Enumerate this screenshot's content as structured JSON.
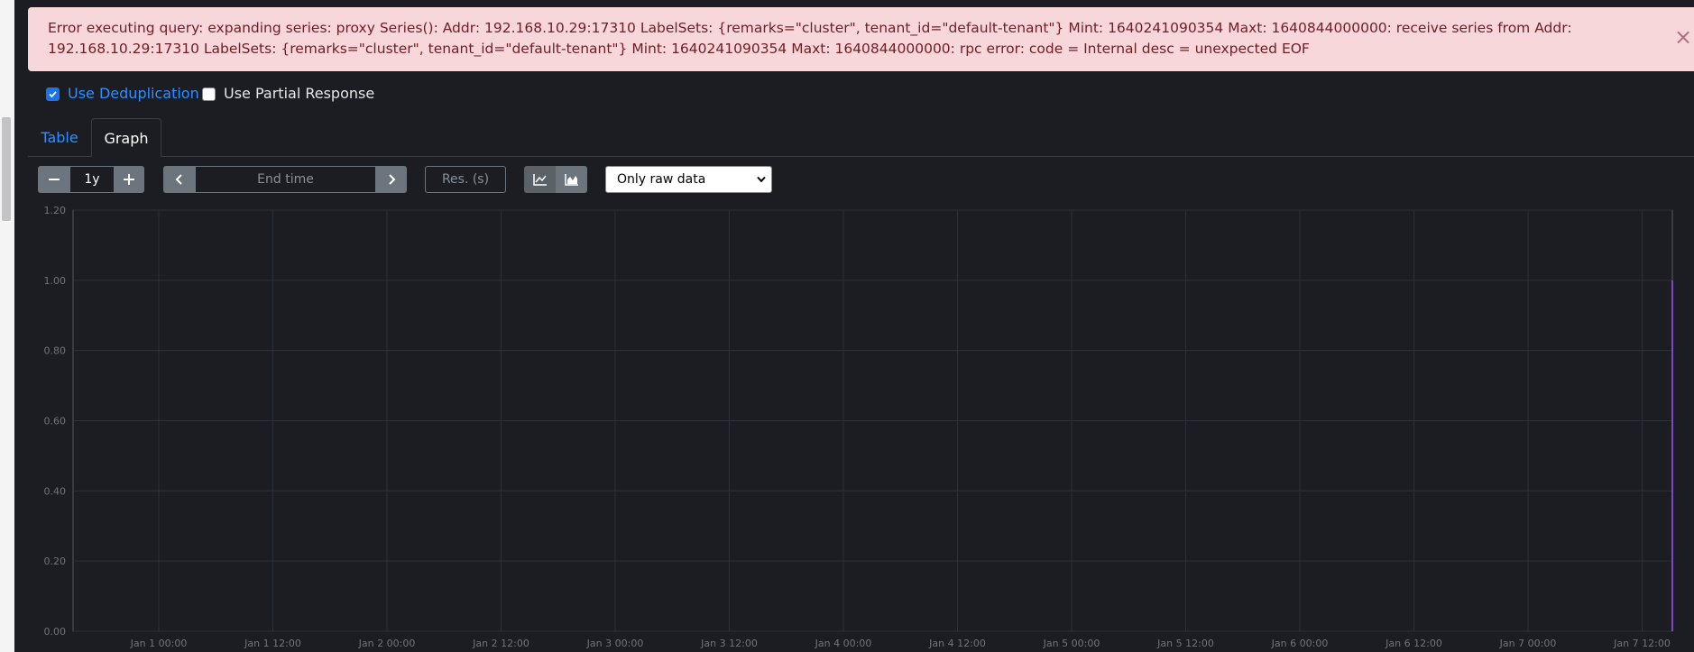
{
  "alert": {
    "message": "Error executing query: expanding series: proxy Series(): Addr: 192.168.10.29:17310 LabelSets: {remarks=\"cluster\", tenant_id=\"default-tenant\"} Mint: 1640241090354 Maxt: 1640844000000: receive series from Addr: 192.168.10.29:17310 LabelSets: {remarks=\"cluster\", tenant_id=\"default-tenant\"} Mint: 1640241090354 Maxt: 1640844000000: rpc error: code = Internal desc = unexpected EOF",
    "close_glyph": "×"
  },
  "options": {
    "deduplication": {
      "label": "Use Deduplication",
      "checked": true
    },
    "partial_response": {
      "label": "Use Partial Response",
      "checked": false
    }
  },
  "tabs": [
    {
      "label": "Table",
      "active": false
    },
    {
      "label": "Graph",
      "active": true
    }
  ],
  "toolbar": {
    "range_value": "1y",
    "end_time_placeholder": "End time",
    "resolution_placeholder": "Res. (s)",
    "selected_option": "Only raw data"
  },
  "colors": {
    "alert_bg": "#f8d7da",
    "alert_text": "#721c24",
    "link_blue": "#2f8fff",
    "series_purple": "#a24cf0",
    "series_yellow": "#e9e15a"
  },
  "chart_data": {
    "type": "line",
    "y_ticks": [
      "0.00",
      "0.20",
      "0.40",
      "0.60",
      "0.80",
      "1.00",
      "1.20"
    ],
    "ylim": [
      0,
      1.2
    ],
    "x_ticks": [
      "Jan 1 00:00",
      "Jan 1 12:00",
      "Jan 2 00:00",
      "Jan 2 12:00",
      "Jan 3 00:00",
      "Jan 3 12:00",
      "Jan 4 00:00",
      "Jan 4 12:00",
      "Jan 5 00:00",
      "Jan 5 12:00",
      "Jan 6 00:00",
      "Jan 6 12:00",
      "Jan 7 00:00",
      "Jan 7 12:00"
    ],
    "grid": true,
    "series": [
      {
        "color": "#a24cf0",
        "points": [
          [
            13.78,
            1.0
          ],
          [
            13.84,
            0.0
          ],
          [
            13.86,
            0.12
          ],
          [
            13.9,
            1.0
          ],
          [
            14.25,
            1.0
          ]
        ]
      },
      {
        "color": "#e9e15a",
        "points": [
          [
            13.78,
            1.0
          ],
          [
            14.25,
            1.0
          ]
        ]
      }
    ]
  }
}
